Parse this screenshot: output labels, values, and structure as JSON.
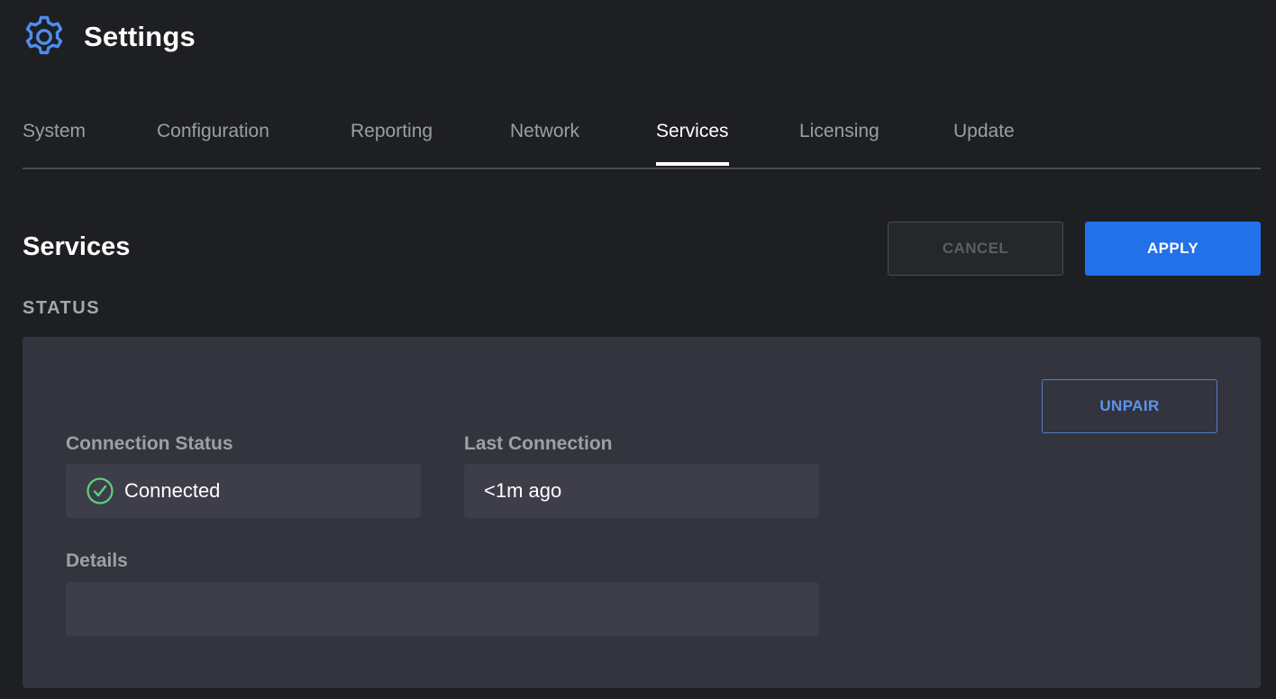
{
  "app": {
    "title": "Settings",
    "icon": "gear-icon",
    "accent_color": "#4d8ef0"
  },
  "tabs": [
    {
      "label": "System",
      "active": false
    },
    {
      "label": "Configuration",
      "active": false
    },
    {
      "label": "Reporting",
      "active": false
    },
    {
      "label": "Network",
      "active": false
    },
    {
      "label": "Services",
      "active": true
    },
    {
      "label": "Licensing",
      "active": false
    },
    {
      "label": "Update",
      "active": false
    }
  ],
  "section": {
    "title": "Services",
    "cancel_label": "CANCEL",
    "apply_label": "APPLY",
    "apply_color": "#2271e8"
  },
  "status": {
    "heading": "STATUS",
    "unpair_label": "UNPAIR",
    "connection_status_label": "Connection Status",
    "connection_status_value": "Connected",
    "connection_status_icon": "check-circle-icon",
    "connection_status_color": "#5ed17a",
    "last_connection_label": "Last Connection",
    "last_connection_value": "<1m ago",
    "details_label": "Details",
    "details_value": ""
  }
}
